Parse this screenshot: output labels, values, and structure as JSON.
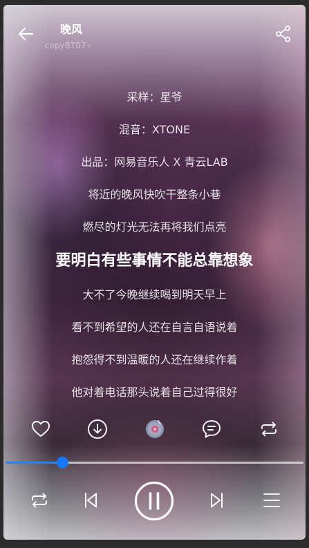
{
  "header": {
    "title": "晚风",
    "artist": "copyBT07",
    "artist_chevron": "›"
  },
  "lyrics": {
    "lines": [
      "采样：星爷",
      "混音：XTONE",
      "出品：网易音乐人 X 青云LAB",
      "将近的晚风快吹干整条小巷",
      "燃尽的灯光无法再将我们点亮",
      "要明白有些事情不能总靠想象",
      "大不了今晚继续喝到明天早上",
      "看不到希望的人还在自言自语说着",
      "抱怨得不到温暖的人还在继续作着",
      "他对着电话那头说着自己过得很好"
    ],
    "active_index": 5
  },
  "actions": {
    "icons": [
      "heart-icon",
      "download-icon",
      "vinyl-icon",
      "comment-icon",
      "repeat-icon"
    ]
  },
  "progress": {
    "fraction": 0.19,
    "fill_color": "#2d80f0",
    "thumb_color": "#1677ff"
  },
  "controls": {
    "icons": [
      "repeat-mode-icon",
      "previous-icon",
      "pause-icon",
      "next-icon",
      "playlist-icon"
    ]
  }
}
